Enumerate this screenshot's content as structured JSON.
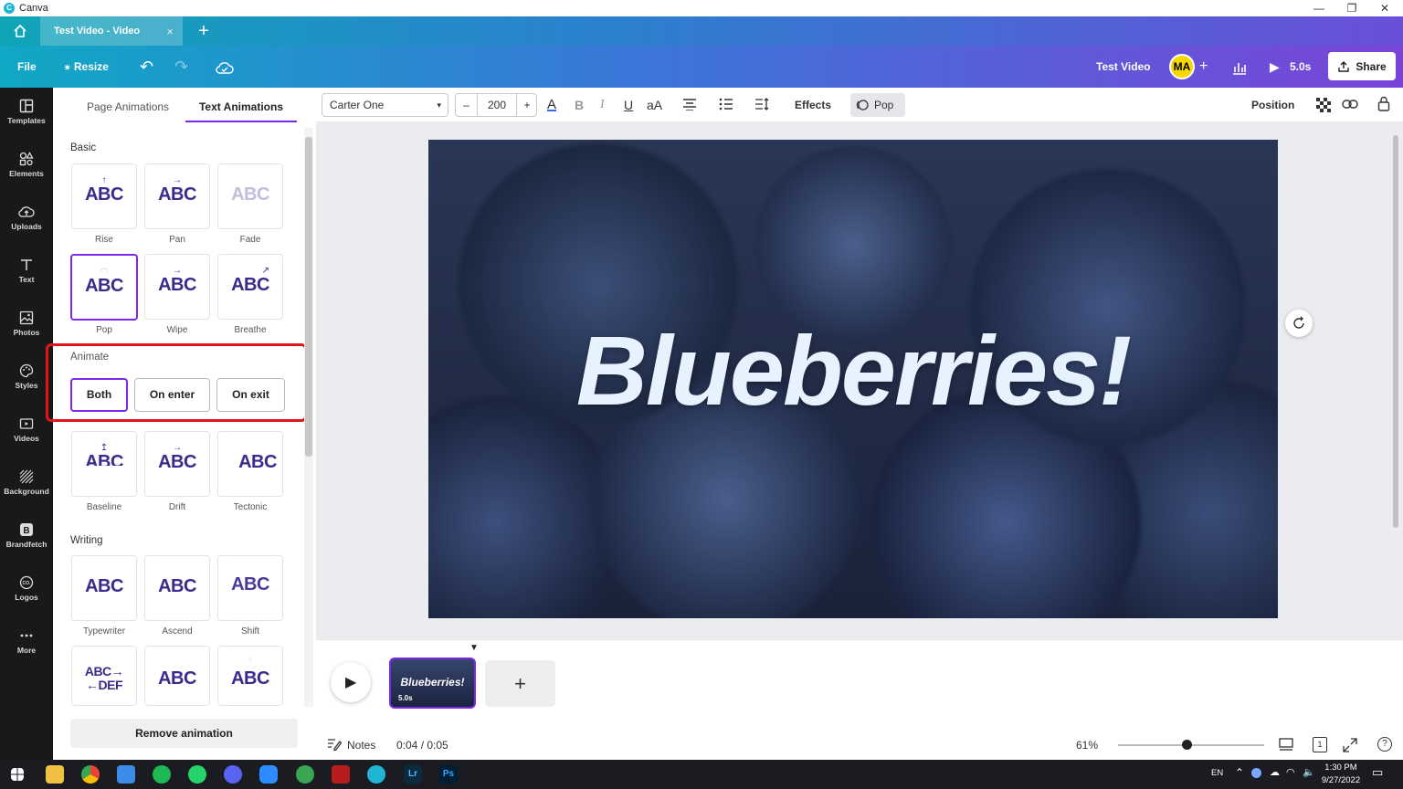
{
  "window": {
    "app_title": "Canva"
  },
  "tabs": {
    "active_tab": "Test Video - Video",
    "close": "×",
    "new_tab": "+"
  },
  "menubar": {
    "file": "File",
    "resize": "Resize",
    "document_title": "Test Video",
    "avatar_initials": "MA",
    "add": "+",
    "play_duration": "5.0s",
    "share": "Share"
  },
  "rail": [
    {
      "label": "Templates"
    },
    {
      "label": "Elements"
    },
    {
      "label": "Uploads"
    },
    {
      "label": "Text"
    },
    {
      "label": "Photos"
    },
    {
      "label": "Styles"
    },
    {
      "label": "Videos"
    },
    {
      "label": "Background"
    },
    {
      "label": "Brandfetch"
    },
    {
      "label": "Logos"
    },
    {
      "label": "More"
    }
  ],
  "panel": {
    "tabs": [
      "Page Animations",
      "Text Animations"
    ],
    "basic_heading": "Basic",
    "basic": [
      {
        "preview": "ABC",
        "label": "Rise"
      },
      {
        "preview": "ABC",
        "label": "Pan"
      },
      {
        "preview": "ABC",
        "label": "Fade"
      },
      {
        "preview": "ABC",
        "label": "Pop"
      },
      {
        "preview": "ABC",
        "label": "Wipe"
      },
      {
        "preview": "ABC",
        "label": "Breathe"
      }
    ],
    "animate_heading": "Animate",
    "animate_options": [
      "Both",
      "On enter",
      "On exit"
    ],
    "more": [
      {
        "preview": "ABC",
        "label": "Baseline"
      },
      {
        "preview": "ABC",
        "label": "Drift"
      },
      {
        "preview": "ABC",
        "label": "Tectonic"
      }
    ],
    "writing_heading": "Writing",
    "writing": [
      {
        "preview": "ABC",
        "label": "Typewriter"
      },
      {
        "preview": "ABC",
        "label": "Ascend"
      },
      {
        "preview": "ABC",
        "label": "Shift"
      },
      {
        "preview": "ABC→ ←DEF",
        "label": ""
      },
      {
        "preview": "ABC",
        "label": ""
      },
      {
        "preview": "ABC",
        "label": ""
      }
    ],
    "remove_button": "Remove animation"
  },
  "toolbar": {
    "font": "Carter One",
    "minus": "–",
    "font_size": "200",
    "plus": "+",
    "bold": "B",
    "italic": "I",
    "underline": "U",
    "case": "aA",
    "effects": "Effects",
    "animation": "Pop",
    "position": "Position"
  },
  "canvas": {
    "text": "Blueberries!"
  },
  "timeline": {
    "thumb_text": "Blueberries!",
    "thumb_duration": "5.0s",
    "add_page": "+"
  },
  "bottombar": {
    "notes": "Notes",
    "time": "0:04 / 0:05",
    "zoom": "61%",
    "page_count": "1",
    "help": "?"
  },
  "taskbar": {
    "language": "EN",
    "time": "1:30 PM",
    "date": "9/27/2022",
    "lr": "Lr",
    "ps": "Ps"
  }
}
